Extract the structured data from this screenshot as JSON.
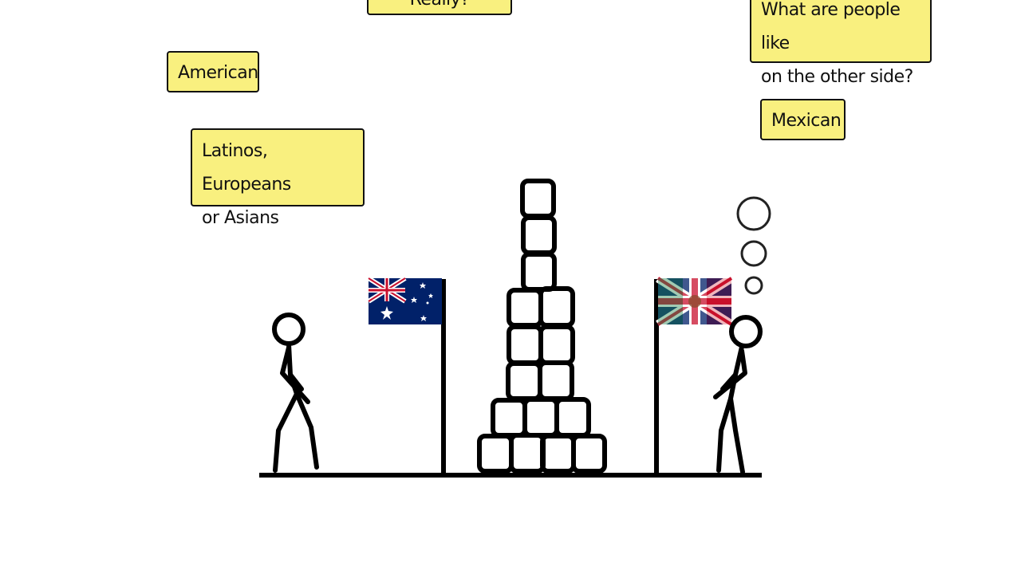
{
  "notes": {
    "top_partial": "Really?",
    "american": "American",
    "latinos": "Latinos, Europeans\n   or Asians",
    "question": "What are people like\non the other side?",
    "mexican": "Mexican"
  },
  "flags": {
    "left": "australian-flag",
    "right": "union-jack-mexican-overlay-flag"
  },
  "colors": {
    "note_bg": "#f9f07f",
    "ink": "#111111",
    "flag_blue": "#012169",
    "flag_red": "#c8102e"
  }
}
